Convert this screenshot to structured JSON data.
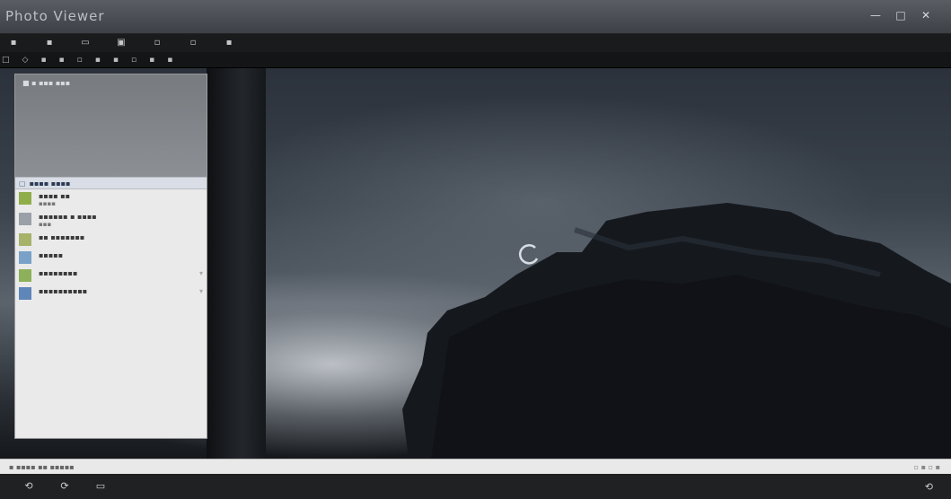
{
  "window": {
    "title": "Photo Viewer",
    "controls": [
      "—",
      "□",
      "✕"
    ]
  },
  "menubar": {
    "items": [
      "▪",
      "▪",
      "▭",
      "▣",
      "▫",
      "▫",
      "▪"
    ]
  },
  "toolbar": {
    "items": [
      "□",
      "◇",
      "▪",
      "▪",
      "▫",
      "▪",
      "▪",
      "▫",
      "▪",
      "▪"
    ]
  },
  "side_panel": {
    "header_text": "■ ▪ ▪▪▪ ▪▪▪",
    "selected_label": "▪▪▪▪ ▪▪▪▪",
    "items": [
      {
        "label": "▪▪▪▪ ▪▪",
        "sub": "▪▪▪▪"
      },
      {
        "label": "▪▪▪▪▪▪ ▪ ▪▪▪▪",
        "sub": "▪▪▪"
      },
      {
        "label": "▪▪ ▪▪▪▪▪▪▪",
        "sub": ""
      },
      {
        "label": "▪▪▪▪▪",
        "sub": ""
      },
      {
        "label": "▪▪▪▪▪▪▪▪",
        "sub": ""
      },
      {
        "label": "▪▪▪▪▪▪▪▪▪▪",
        "sub": ""
      }
    ],
    "thumb_colors": [
      "#8fae4a",
      "#9aa0a8",
      "#a7b26a",
      "#7aa2c8",
      "#8db05a",
      "#5f86b8"
    ]
  },
  "statusbar": {
    "left_text": "▪ ▪▪▪▪ ▪▪ ▪▪▪▪▪",
    "right_text": "▫ ▪ ▫ ▪"
  },
  "bottombar": {
    "items": [
      "⟲",
      "⟳",
      "▭"
    ],
    "right": "⟲"
  }
}
